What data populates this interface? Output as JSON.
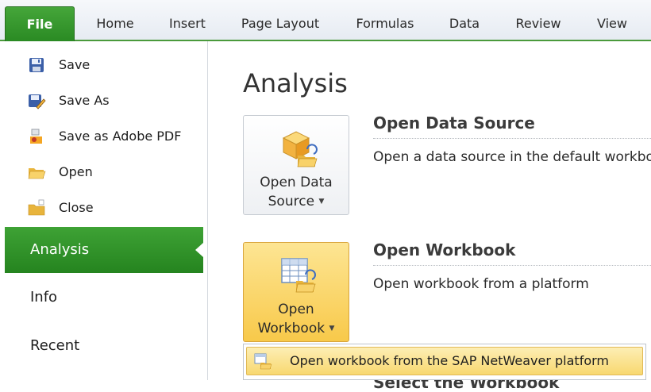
{
  "ribbon": {
    "tabs": [
      "File",
      "Home",
      "Insert",
      "Page Layout",
      "Formulas",
      "Data",
      "Review",
      "View"
    ],
    "active_tab": "File",
    "accent_color": "#2f8f27"
  },
  "backstage": {
    "commands": [
      {
        "label": "Save",
        "icon": "floppy-disk-icon"
      },
      {
        "label": "Save As",
        "icon": "save-as-icon"
      },
      {
        "label": "Save as Adobe PDF",
        "icon": "adobe-pdf-icon"
      },
      {
        "label": "Open",
        "icon": "open-folder-icon"
      },
      {
        "label": "Close",
        "icon": "close-folder-icon"
      }
    ],
    "nav_items": [
      {
        "label": "Analysis",
        "active": true
      },
      {
        "label": "Info",
        "active": false
      },
      {
        "label": "Recent",
        "active": false
      }
    ]
  },
  "main": {
    "title": "Analysis",
    "sections": [
      {
        "button_label_line1": "Open Data",
        "button_label_line2": "Source",
        "heading": "Open Data Source",
        "description": "Open a data source in the default workbook",
        "icon": "data-source-cube-icon"
      },
      {
        "button_label_line1": "Open",
        "button_label_line2": "Workbook",
        "heading": "Open Workbook",
        "description": "Open workbook from a platform",
        "icon": "workbook-grid-icon"
      }
    ],
    "dropdown": {
      "item_label": "Open workbook from the SAP NetWeaver platform",
      "icon": "sap-platform-icon"
    },
    "partially_hidden_heading": "Select the Workbook"
  }
}
